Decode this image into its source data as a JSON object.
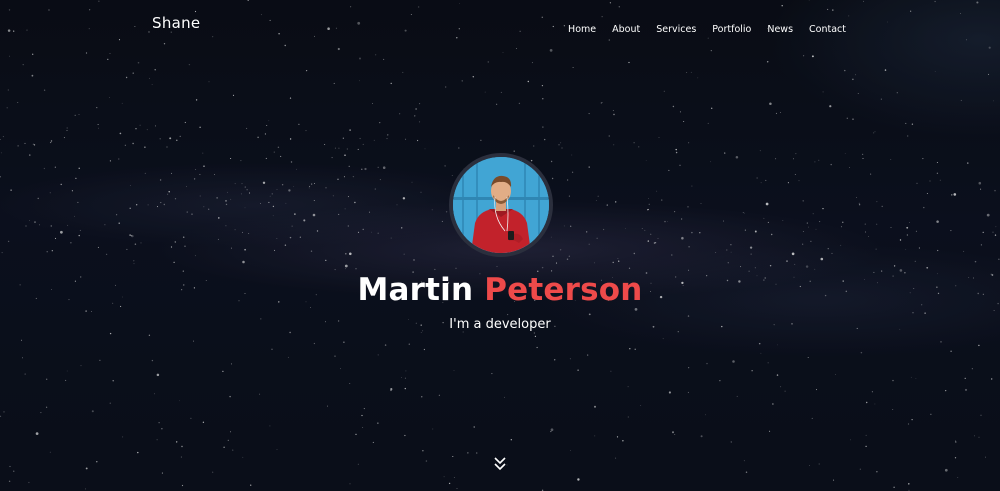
{
  "brand": {
    "label": "Shane"
  },
  "nav": {
    "items": [
      {
        "label": "Home"
      },
      {
        "label": "About"
      },
      {
        "label": "Services"
      },
      {
        "label": "Portfolio"
      },
      {
        "label": "News"
      },
      {
        "label": "Contact"
      }
    ]
  },
  "hero": {
    "first_name": "Martin",
    "last_name": "Peterson",
    "tagline": "I'm a developer",
    "scroll_icon": "double-chevron-down-icon",
    "avatar_icon": "profile-photo"
  },
  "colors": {
    "accent": "#ee4a4a",
    "background": "#0b0e18",
    "text": "#ffffff",
    "avatar_border": "#2b2f3d"
  }
}
